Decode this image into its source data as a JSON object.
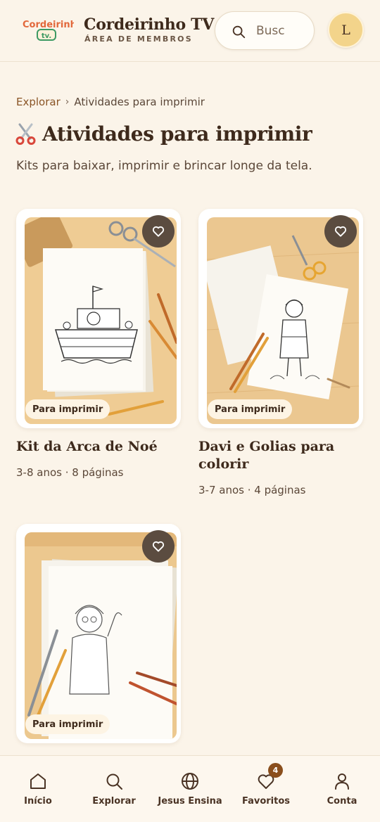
{
  "header": {
    "logo_text_top": "Cordeirinho",
    "logo_text_bottom": "tv.",
    "title": "Cordeirinho TV",
    "subtitle": "ÁREA DE MEMBROS",
    "search_placeholder": "Busc",
    "search_icon": "search-icon",
    "avatar_initial": "L"
  },
  "breadcrumb": {
    "parent": "Explorar",
    "separator": "›",
    "current": "Atividades para imprimir"
  },
  "page": {
    "title": "Atividades para imprimir",
    "title_icon": "scissors-icon",
    "subtitle": "Kits para baixar, imprimir e brincar longe da tela."
  },
  "cards": [
    {
      "title": "Kit da Arca de Noé",
      "meta": "3-8 anos · 8 páginas",
      "badge": "Para imprimir",
      "image": "noahs-ark-coloring-page"
    },
    {
      "title": "Davi e Golias para colorir",
      "meta": "3-7 anos · 4 páginas",
      "badge": "Para imprimir",
      "image": "david-coloring-page"
    },
    {
      "title": "",
      "meta": "",
      "badge": "Para imprimir",
      "image": "teacher-coloring-page"
    }
  ],
  "bottom_nav": {
    "items": [
      {
        "label": "Início",
        "icon": "home-icon"
      },
      {
        "label": "Explorar",
        "icon": "search-icon"
      },
      {
        "label": "Jesus Ensina",
        "icon": "globe-icon"
      },
      {
        "label": "Favoritos",
        "icon": "heart-icon",
        "badge": "4"
      },
      {
        "label": "Conta",
        "icon": "user-icon"
      }
    ]
  },
  "colors": {
    "background": "#fbf4e9",
    "text_dark": "#3e2a1c",
    "accent_brown": "#8a5526",
    "avatar_bg": "#f3d48b",
    "fav_button_bg": "#5b4c40",
    "nav_badge_bg": "#8a4e1c"
  }
}
